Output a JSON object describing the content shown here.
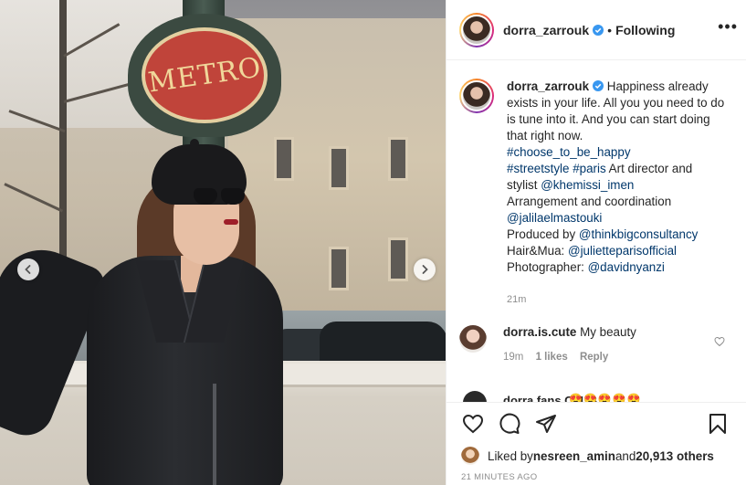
{
  "header": {
    "username": "dorra_zarrouk",
    "separator": "•",
    "follow_status": "Following",
    "more": "•••"
  },
  "photo": {
    "sign_text": "METRO"
  },
  "caption": {
    "username": "dorra_zarrouk",
    "text_1": " Happiness already exists in your life. All you you need to do is tune into it. And you can start doing that right now.",
    "hashtag_1": "#choose_to_be_happy",
    "hashtag_2": "#streetstyle",
    "hashtag_3": "#paris",
    "text_2": " Art director and stylist ",
    "mention_1": "@khemissi_imen",
    "text_3": "Arrangement and coordination",
    "mention_2": "@jalilaelmastouki",
    "text_4": "Produced by ",
    "mention_3": "@thinkbigconsultancy",
    "text_5": "Hair&Mua: ",
    "mention_4": "@julietteparisofficial",
    "text_6": "Photographer: ",
    "mention_5": "@davidnyanzi",
    "time": "21m"
  },
  "comment": {
    "username": "dorra.is.cute",
    "text": " My beauty",
    "time": "19m",
    "likes": "likes",
    "reply": "Reply"
  },
  "peek_comment": {
    "username": "dorra.fans.CLUB",
    "emoji": "😍😍😍😍😍"
  },
  "likes": {
    "prefix": "Liked by ",
    "user": "nesreen_amin",
    "middle": " and ",
    "count": "20,913 others"
  },
  "timestamp": "21 MINUTES AGO",
  "icons": {
    "verified": "verified-badge-icon",
    "prev": "chevron-left-icon",
    "next": "chevron-right-icon",
    "like": "heart-icon",
    "comment": "comment-icon",
    "share": "paper-plane-icon",
    "save": "bookmark-icon"
  },
  "colors": {
    "link": "#00376b",
    "verified": "#3897f0",
    "muted": "#8e8e8e",
    "text": "#262626"
  }
}
